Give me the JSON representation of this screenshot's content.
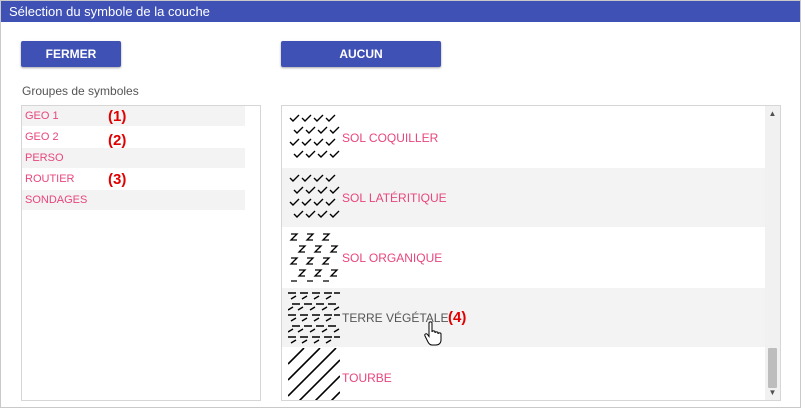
{
  "dialog": {
    "title": "Sélection du symbole de la couche",
    "close_button": "FERMER",
    "none_button": "AUCUN",
    "groups_label": "Groupes de symboles"
  },
  "groups": [
    {
      "label": "GEO 1",
      "annotation": "(1)"
    },
    {
      "label": "GEO 2",
      "annotation": "(2)"
    },
    {
      "label": "PERSO",
      "annotation": ""
    },
    {
      "label": "ROUTIER",
      "annotation": "(3)"
    },
    {
      "label": "SONDAGES",
      "annotation": ""
    }
  ],
  "symbols": [
    {
      "label": "SOL COQUILLER",
      "pattern": "checkmarks-hatch-icon"
    },
    {
      "label": "SOL LATÉRITIQUE",
      "pattern": "checkmarks-hatch-icon"
    },
    {
      "label": "SOL ORGANIQUE",
      "pattern": "z-letters-hatch-icon"
    },
    {
      "label": "TERRE VÉGÉTALE",
      "pattern": "dense-dash-hatch-icon",
      "annotation": "(4)"
    },
    {
      "label": "TOURBE",
      "pattern": "diagonal-lines-hatch-icon"
    }
  ],
  "colors": {
    "accent": "#3f51b5",
    "link": "#e8467c",
    "annotation": "#e00000",
    "row_alt": "#f3f3f3"
  }
}
